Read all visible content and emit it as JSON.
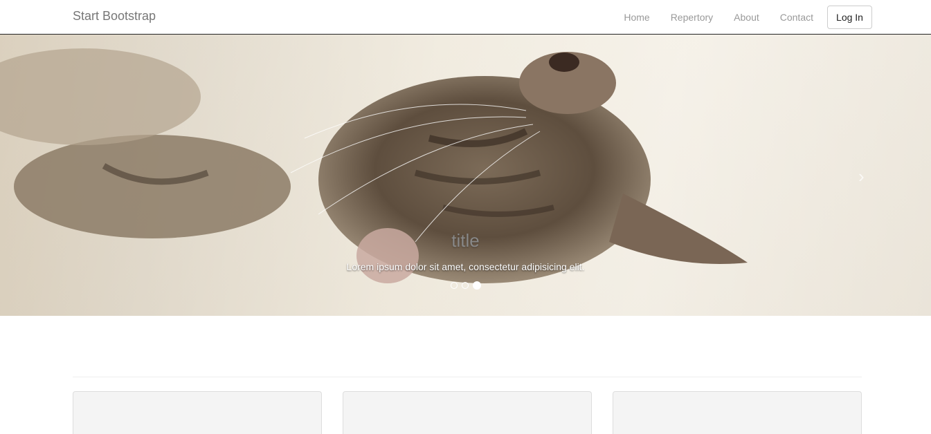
{
  "navbar": {
    "brand": "Start Bootstrap",
    "links": [
      {
        "label": "Home"
      },
      {
        "label": "Repertory"
      },
      {
        "label": "About"
      },
      {
        "label": "Contact"
      }
    ],
    "login_label": "Log In"
  },
  "carousel": {
    "caption_title": "title",
    "caption_text": "Lorem ipsum dolor sit amet, consectetur adipisicing elit.",
    "slide_count": 3,
    "active_index": 2,
    "prev_icon": "chevron-left-icon",
    "next_icon": "chevron-right-icon",
    "next_glyph": "›"
  },
  "colors": {
    "navbar_border": "#222222",
    "brand": "#777777",
    "nav_link": "#999999",
    "card_bg": "#f4f4f4"
  }
}
